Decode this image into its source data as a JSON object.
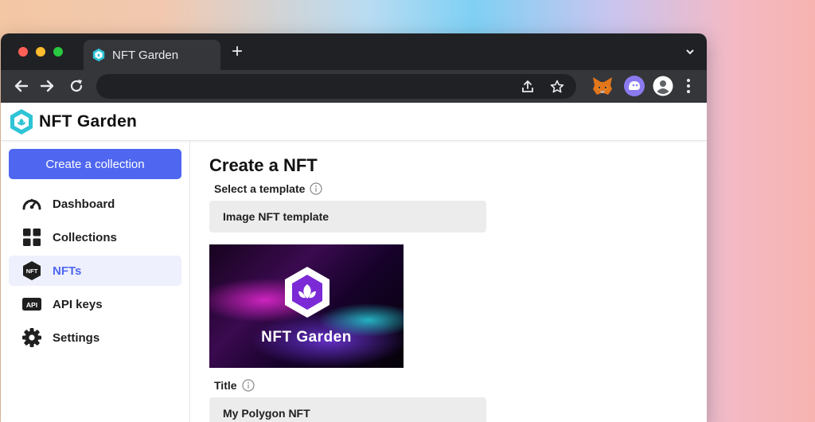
{
  "browser": {
    "tab_title": "NFT Garden",
    "new_tab_symbol": "+",
    "address": ""
  },
  "app": {
    "brand_name": "NFT Garden",
    "accent_color": "#4f67f0"
  },
  "sidebar": {
    "create_button_label": "Create a collection",
    "items": [
      {
        "label": "Dashboard",
        "icon": "dashboard-gauge-icon",
        "active": false
      },
      {
        "label": "Collections",
        "icon": "grid-icon",
        "active": false
      },
      {
        "label": "NFTs",
        "icon": "nft-hexagon-icon",
        "active": true
      },
      {
        "label": "API keys",
        "icon": "api-key-icon",
        "active": false
      },
      {
        "label": "Settings",
        "icon": "gear-icon",
        "active": false
      }
    ]
  },
  "main": {
    "page_title": "Create a NFT",
    "template_label": "Select a template",
    "template_value": "Image NFT template",
    "preview_image_text": "NFT Garden",
    "title_label": "Title",
    "title_value": "My Polygon NFT"
  }
}
